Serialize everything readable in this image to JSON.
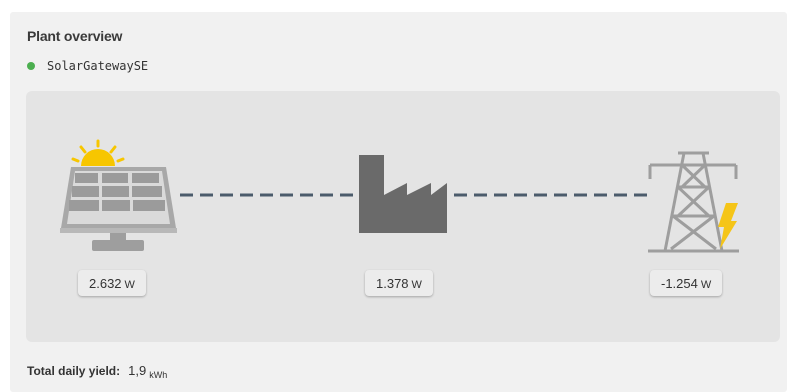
{
  "card": {
    "title": "Plant overview"
  },
  "gateway": {
    "name": "SolarGatewaySE",
    "status_color": "#4caf50"
  },
  "flow": {
    "solar": {
      "icon": "solar-panel-icon",
      "value": "2.632",
      "unit": "W"
    },
    "house": {
      "icon": "factory-icon",
      "value": "1.378",
      "unit": "W"
    },
    "grid": {
      "icon": "power-pylon-icon",
      "value": "-1.254",
      "unit": "W"
    }
  },
  "footer": {
    "label": "Total daily yield:",
    "value": "1,9",
    "unit": "kWh"
  },
  "colors": {
    "flow_line": "#4b5b6b",
    "icon_gray": "#9e9e9e",
    "factory": "#6a6a6a",
    "sun": "#f7c600",
    "lightning": "#f5c518"
  }
}
